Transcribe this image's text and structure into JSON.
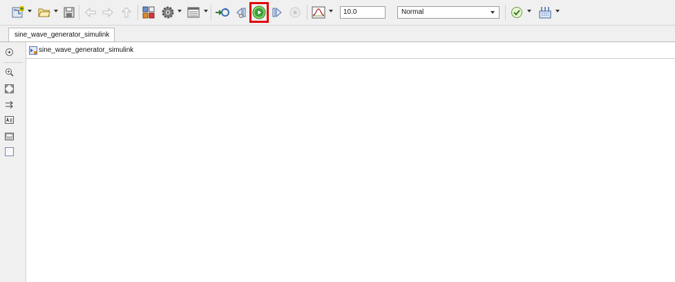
{
  "toolbar": {
    "stop_time_value": "10.0",
    "simulation_mode": "Normal",
    "icons": [
      "new-model-icon",
      "open-icon",
      "save-icon",
      "back-arrow-icon",
      "forward-arrow-icon",
      "up-arrow-icon",
      "library-browser-icon",
      "model-settings-gear-icon",
      "model-explorer-icon",
      "update-diagram-icon",
      "step-back-icon",
      "run-icon",
      "step-forward-icon",
      "stop-icon",
      "scope-icon",
      "model-advisor-check-icon",
      "build-icon"
    ]
  },
  "tabs": [
    {
      "label": "sine_wave_generator_simulink"
    }
  ],
  "address_bar": {
    "model_name": "sine_wave_generator_simulink"
  },
  "palette": {
    "icons": [
      "hide-browser-icon",
      "zoom-in-icon",
      "fit-to-view-icon",
      "arrow-connect-icon",
      "annotation-icon",
      "image-icon",
      "area-icon"
    ]
  },
  "colors": {
    "highlight": "#e00000",
    "run_green": "#3aa53a"
  }
}
